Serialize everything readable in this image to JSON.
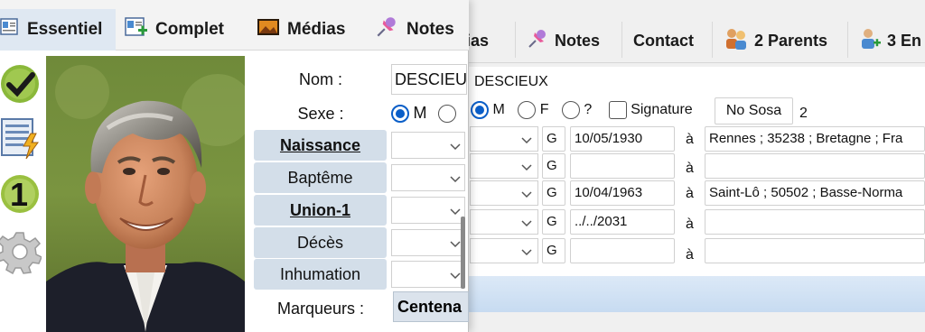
{
  "back_window": {
    "tabs": [
      {
        "label": "dias",
        "icon": "media-icon"
      },
      {
        "label": "Notes",
        "icon": "pushpin-icon"
      },
      {
        "label": "Contact",
        "icon": ""
      },
      {
        "label": "2 Parents",
        "icon": "parents-icon"
      },
      {
        "label": "3 En",
        "icon": "person-add-icon"
      }
    ],
    "name_value": "DESCIEUX",
    "sex_options": [
      "M",
      "F",
      "?"
    ],
    "sex_selected": "M",
    "signature_label": "Signature",
    "sosa_button": "No Sosa",
    "sosa_number": "2",
    "events": [
      {
        "qualifier": "G",
        "date": "10/05/1930",
        "at": "à",
        "place": "Rennes ; 35238 ; Bretagne ; Fra"
      },
      {
        "qualifier": "G",
        "date": "",
        "at": "à",
        "place": ""
      },
      {
        "qualifier": "G",
        "date": "10/04/1963",
        "at": "à",
        "place": "Saint-Lô ; 50502 ; Basse-Norma"
      },
      {
        "qualifier": "G",
        "date": "../../2031",
        "at": "à",
        "place": ""
      },
      {
        "qualifier": "G",
        "date": "",
        "at": "à",
        "place": ""
      }
    ]
  },
  "front_window": {
    "tabs": [
      {
        "label": "Essentiel",
        "icon": "essential-icon",
        "active": true
      },
      {
        "label": "Complet",
        "icon": "complete-icon",
        "active": false
      },
      {
        "label": "Médias",
        "icon": "media-icon",
        "active": false
      },
      {
        "label": "Notes",
        "icon": "pushpin-icon",
        "active": false
      }
    ],
    "side_icons": [
      "checkmark-icon",
      "lightning-document-icon",
      "number-one-icon",
      "gear-icon"
    ],
    "number_badge": "1",
    "fields": {
      "name_label": "Nom :",
      "name_value": "DESCIEU",
      "sex_label": "Sexe :",
      "sex_option_m": "M"
    },
    "events": [
      {
        "label": "Naissance",
        "emphasized": true
      },
      {
        "label": "Baptême",
        "emphasized": false
      },
      {
        "label": "Union-1",
        "emphasized": true
      },
      {
        "label": "Décès",
        "emphasized": false
      },
      {
        "label": "Inhumation",
        "emphasized": false
      }
    ],
    "markers_label": "Marqueurs :",
    "markers_value": "Centena"
  }
}
